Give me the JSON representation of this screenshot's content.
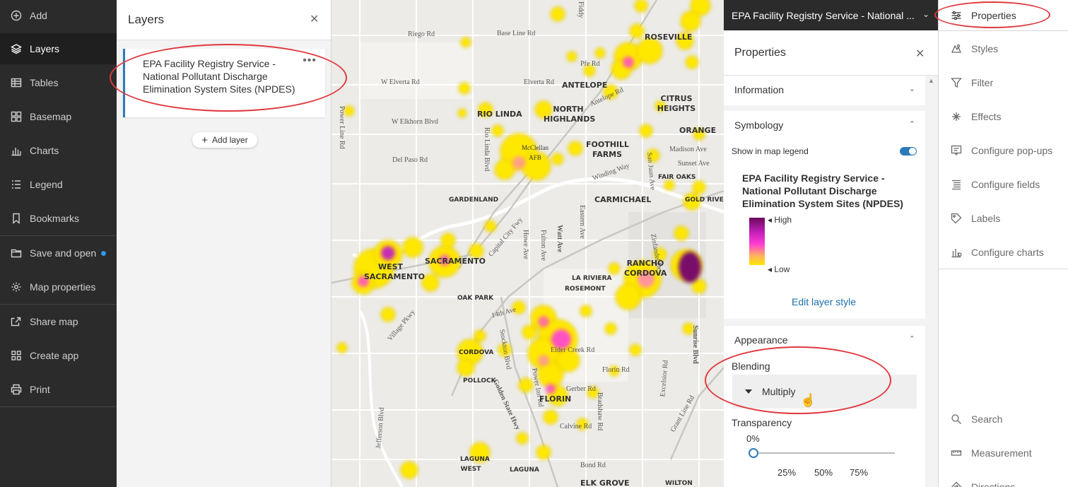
{
  "nav": {
    "items": [
      {
        "label": "Add",
        "icon": "plus-circle-icon"
      },
      {
        "label": "Layers",
        "icon": "layers-icon"
      },
      {
        "label": "Tables",
        "icon": "table-icon"
      },
      {
        "label": "Basemap",
        "icon": "basemap-icon"
      },
      {
        "label": "Charts",
        "icon": "chart-icon"
      },
      {
        "label": "Legend",
        "icon": "legend-icon"
      },
      {
        "label": "Bookmarks",
        "icon": "bookmark-icon"
      },
      {
        "label": "Save and open",
        "icon": "folder-icon"
      },
      {
        "label": "Map properties",
        "icon": "gear-icon"
      },
      {
        "label": "Share map",
        "icon": "share-icon"
      },
      {
        "label": "Create app",
        "icon": "apps-icon"
      },
      {
        "label": "Print",
        "icon": "print-icon"
      }
    ]
  },
  "layers_panel": {
    "title": "Layers",
    "layer_name": "EPA Facility Registry Service - National Pollutant Discharge Elimination System Sites (NPDES)",
    "add_layer": "Add layer"
  },
  "map": {
    "labels": [
      "Riego Rd",
      "Base Line Rd",
      "W Elverta Rd",
      "Elverta Rd",
      "W Elkhorn Blvd",
      "Del Paso Rd",
      "Power Line Rd",
      "Rio Linda Blvd",
      "Winding Way",
      "Madison Ave",
      "Sunset Ave",
      "Capital City Fwy",
      "Howe Ave",
      "Fulton Ave",
      "Watt Ave",
      "Eastern Ave",
      "14th Ave",
      "Stockton Blvd",
      "Village Pkwy",
      "Elder Creek Rd",
      "Florin Rd",
      "Gerber Rd",
      "Calvine Rd",
      "Bond Rd",
      "Power Inn Rd",
      "Bradshaw Rd",
      "Excelsior Rd",
      "Grant Line Rd",
      "Sunrise Blvd",
      "Jefferson Blvd",
      "Golden State Hwy",
      "Pfe Rd",
      "Antelope Rd",
      "Zinfandel Dr",
      "San Juan Ave",
      "Fiddy"
    ],
    "cities": [
      "ROSEVILLE",
      "ANTELOPE",
      "CITRUS HEIGHTS",
      "RIO LINDA",
      "NORTH HIGHLANDS",
      "ORANGE",
      "McClellan AFB",
      "FOOTHILL FARMS",
      "FAIR OAKS",
      "GARDENLAND",
      "CARMICHAEL",
      "GOLD RIVER",
      "WEST SACRAMENTO",
      "SACRAMENTO",
      "RANCHO CORDOVA",
      "LA RIVIERA",
      "ROSEMONT",
      "OAK PARK",
      "CORDOVA",
      "POLLOCK",
      "FLORIN",
      "LAGUNA WEST",
      "LAGUNA",
      "ELK GROVE",
      "WILTON"
    ]
  },
  "properties": {
    "layer_dropdown": "EPA Facility Registry Service - National ...",
    "title": "Properties",
    "information": "Information",
    "symbology": "Symbology",
    "show_in_legend": "Show in map legend",
    "legend_title": "EPA Facility Registry Service - National Pollutant Discharge Elimination System Sites (NPDES)",
    "ramp_high": "High",
    "ramp_low": "Low",
    "edit_style": "Edit layer style",
    "appearance": "Appearance",
    "blending_label": "Blending",
    "blending_value": "Multiply",
    "transparency_label": "Transparency",
    "transparency_value": "0%",
    "ticks": [
      "25%",
      "50%",
      "75%"
    ]
  },
  "tools": {
    "items": [
      {
        "label": "Properties",
        "icon": "sliders-icon"
      },
      {
        "label": "Styles",
        "icon": "styles-icon"
      },
      {
        "label": "Filter",
        "icon": "filter-icon"
      },
      {
        "label": "Effects",
        "icon": "sparkle-icon"
      },
      {
        "label": "Configure pop-ups",
        "icon": "popup-icon"
      },
      {
        "label": "Configure fields",
        "icon": "fields-icon"
      },
      {
        "label": "Labels",
        "icon": "label-icon"
      },
      {
        "label": "Configure charts",
        "icon": "chart-config-icon"
      }
    ],
    "bottom": [
      {
        "label": "Search",
        "icon": "search-icon"
      },
      {
        "label": "Measurement",
        "icon": "ruler-icon"
      },
      {
        "label": "Directions",
        "icon": "directions-icon"
      }
    ]
  },
  "colors": {
    "nav_bg": "#2b2b2b",
    "accent": "#2c7bb8",
    "annotation": "#e0393f",
    "heat_low": "#ffe800",
    "heat_high": "#6a0a5a"
  }
}
